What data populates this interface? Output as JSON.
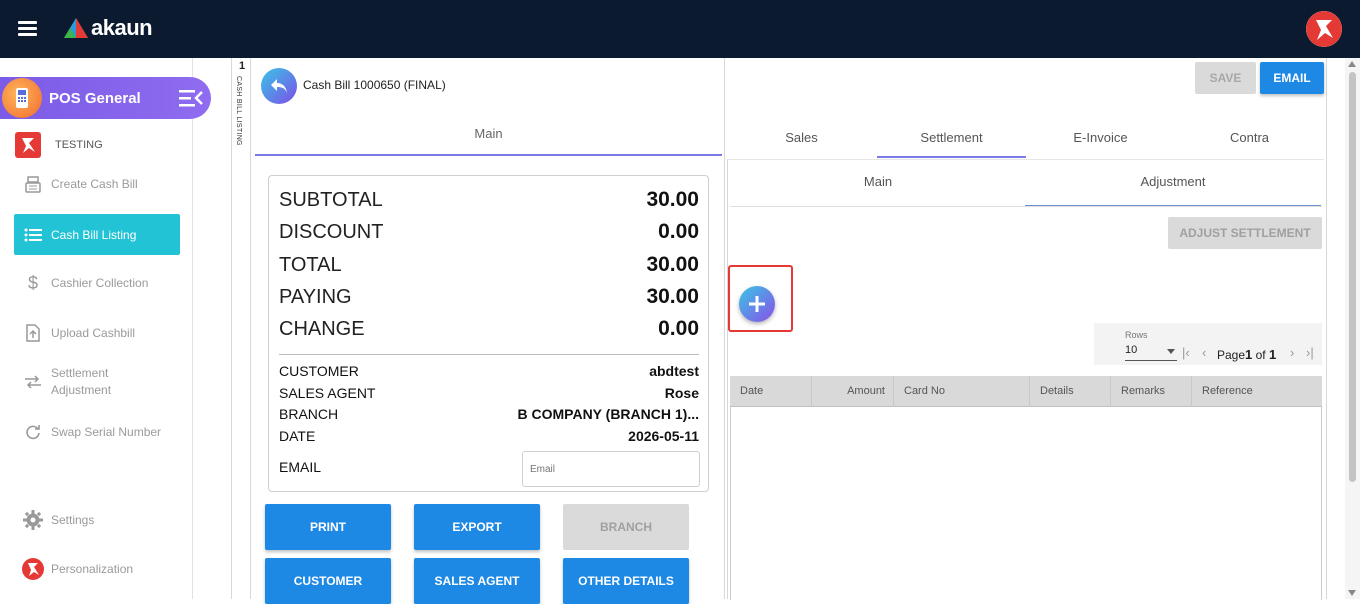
{
  "header": {
    "logo_text": "akaun",
    "menu_icon": "hamburger-icon",
    "brand_icon": "akaun-brand-icon"
  },
  "sidebar": {
    "app_name": "POS General",
    "group_label": "TESTING",
    "items": [
      {
        "label": "Create Cash Bill",
        "icon": "cash-register-icon"
      },
      {
        "label": "Cash Bill Listing",
        "icon": "list-icon",
        "active": true
      },
      {
        "label": "Cashier Collection",
        "icon": "dollar-icon"
      },
      {
        "label": "Upload Cashbill",
        "icon": "upload-file-icon"
      },
      {
        "label": "Settlement\nAdjustment",
        "icon": "swap-horizontal-icon"
      },
      {
        "label": "Swap Serial Number",
        "icon": "refresh-icon"
      }
    ],
    "settings_label": "Settings",
    "personalization_label": "Personalization"
  },
  "listing_tab": {
    "number": "1",
    "label": "CASH BILL LISTING"
  },
  "left": {
    "title": "Cash Bill 1000650 (FINAL)",
    "main_tab": "Main",
    "summary": {
      "subtotal_label": "SUBTOTAL",
      "subtotal": "30.00",
      "discount_label": "DISCOUNT",
      "discount": "0.00",
      "total_label": "TOTAL",
      "total": "30.00",
      "paying_label": "PAYING",
      "paying": "30.00",
      "change_label": "CHANGE",
      "change": "0.00"
    },
    "details": {
      "customer_label": "CUSTOMER",
      "customer": "abdtest",
      "sales_agent_label": "SALES AGENT",
      "sales_agent": "Rose",
      "branch_label": "BRANCH",
      "branch": "B COMPANY (BRANCH 1)...",
      "date_label": "DATE",
      "date": "2026-05-11",
      "email_label": "EMAIL",
      "email_placeholder": "Email"
    },
    "buttons": {
      "print": "PRINT",
      "export": "EXPORT",
      "branch": "BRANCH",
      "customer": "CUSTOMER",
      "sales_agent": "SALES AGENT",
      "other_details": "OTHER DETAILS"
    }
  },
  "right": {
    "save_label": "SAVE",
    "email_label": "EMAIL",
    "tabs": [
      "Sales",
      "Settlement",
      "E-Invoice",
      "Contra"
    ],
    "active_tab": "Settlement",
    "sub_tabs": [
      "Main",
      "Adjustment"
    ],
    "active_sub_tab": "Adjustment",
    "adjust_label": "ADJUST SETTLEMENT",
    "pager": {
      "rows_label": "Rows",
      "rows_value": "10",
      "page_word": "Page",
      "page": "1",
      "of_word": "of",
      "total_pages": "1"
    },
    "columns": [
      "Date",
      "Amount",
      "Card No",
      "Details",
      "Remarks",
      "Reference"
    ]
  },
  "colors": {
    "topbar": "#0b1a2e",
    "active_item": "#23c3d6",
    "primary_button": "#1e88e5",
    "highlight_border": "#e53935"
  }
}
